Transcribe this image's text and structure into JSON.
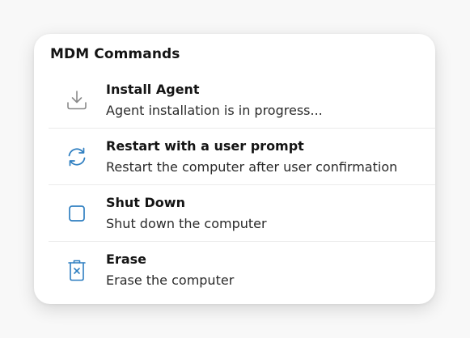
{
  "panel": {
    "title": "MDM Commands"
  },
  "commands": [
    {
      "title": "Install Agent",
      "description": "Agent installation is in progress...",
      "icon": "download-icon",
      "icon_color": "#8a8a8a"
    },
    {
      "title": "Restart with a user prompt",
      "description": "Restart the computer after user confirmation",
      "icon": "refresh-icon",
      "icon_color": "#2f7fc1"
    },
    {
      "title": "Shut Down",
      "description": "Shut down the computer",
      "icon": "square-stop-icon",
      "icon_color": "#2f7fc1"
    },
    {
      "title": "Erase",
      "description": "Erase the computer",
      "icon": "trash-x-icon",
      "icon_color": "#2f7fc1"
    }
  ]
}
